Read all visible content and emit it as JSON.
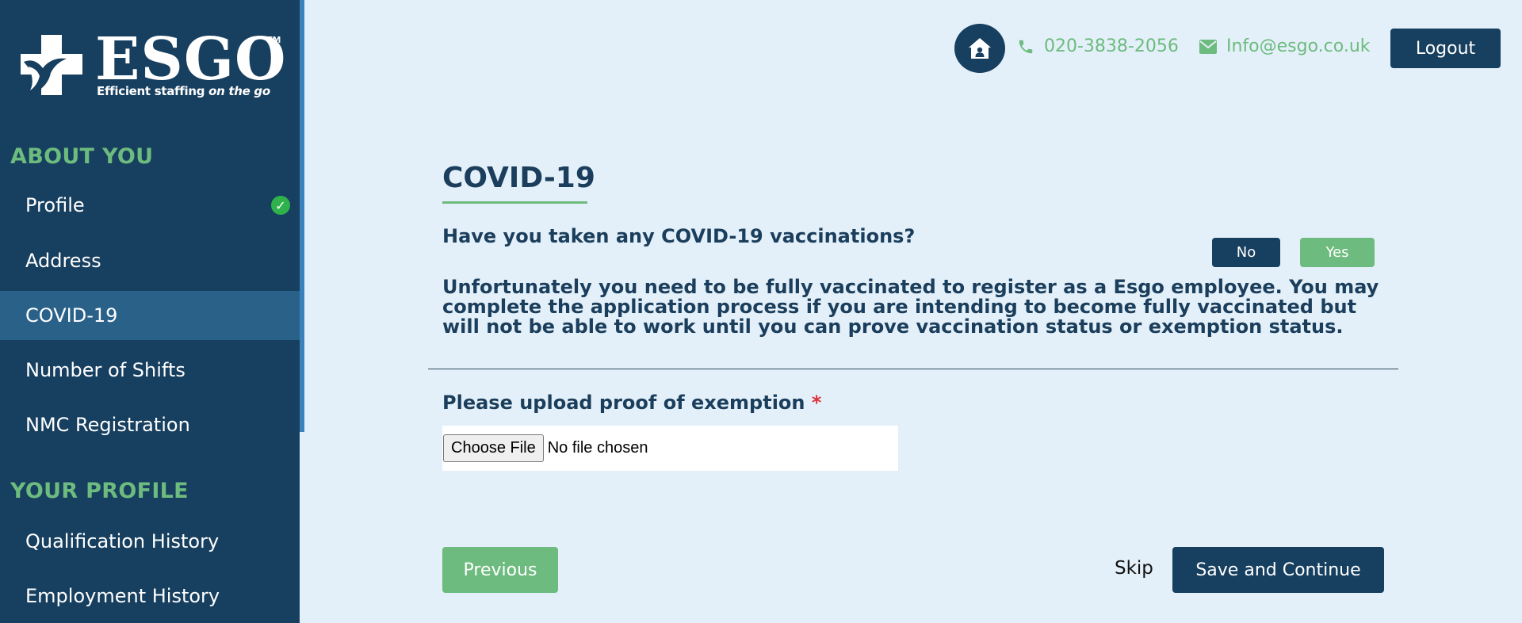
{
  "brand": {
    "name": "ESGO",
    "trademark": "TM",
    "tagline_main": "Efficient staffing ",
    "tagline_italic": "on the go"
  },
  "sidebar": {
    "sections": [
      {
        "title": "ABOUT YOU",
        "items": [
          {
            "label": "Profile",
            "completed": true,
            "active": false
          },
          {
            "label": "Address",
            "completed": false,
            "active": false
          },
          {
            "label": "COVID-19",
            "completed": false,
            "active": true
          },
          {
            "label": "Number of Shifts",
            "completed": false,
            "active": false
          },
          {
            "label": "NMC Registration",
            "completed": false,
            "active": false
          }
        ]
      },
      {
        "title": "YOUR PROFILE",
        "items": [
          {
            "label": "Qualification History",
            "completed": false,
            "active": false
          },
          {
            "label": "Employment History",
            "completed": false,
            "active": false
          }
        ]
      }
    ],
    "check_glyph": "✓"
  },
  "header": {
    "home_icon": "home-icon",
    "phone": "020-3838-2056",
    "email": "Info@esgo.co.uk",
    "logout_label": "Logout"
  },
  "main": {
    "title": "COVID-19",
    "question": "Have you taken any COVID-19 vaccinations?",
    "no_label": "No",
    "yes_label": "Yes",
    "notice": "Unfortunately you need to be fully vaccinated to register as a Esgo employee. You may complete the application process if you are intending to become fully vaccinated but will not be able to work until you can prove vaccination status or exemption status.",
    "upload_label": "Please upload proof of exemption",
    "required_mark": "*",
    "file_button": "Choose File",
    "file_status": "No file chosen",
    "previous_label": "Previous",
    "skip_label": "Skip",
    "save_label": "Save and Continue"
  },
  "colors": {
    "navy": "#173f5f",
    "green": "#6dbb7e",
    "active_nav": "#2a6189",
    "background": "#e4f0f9",
    "required": "#e0313a"
  }
}
